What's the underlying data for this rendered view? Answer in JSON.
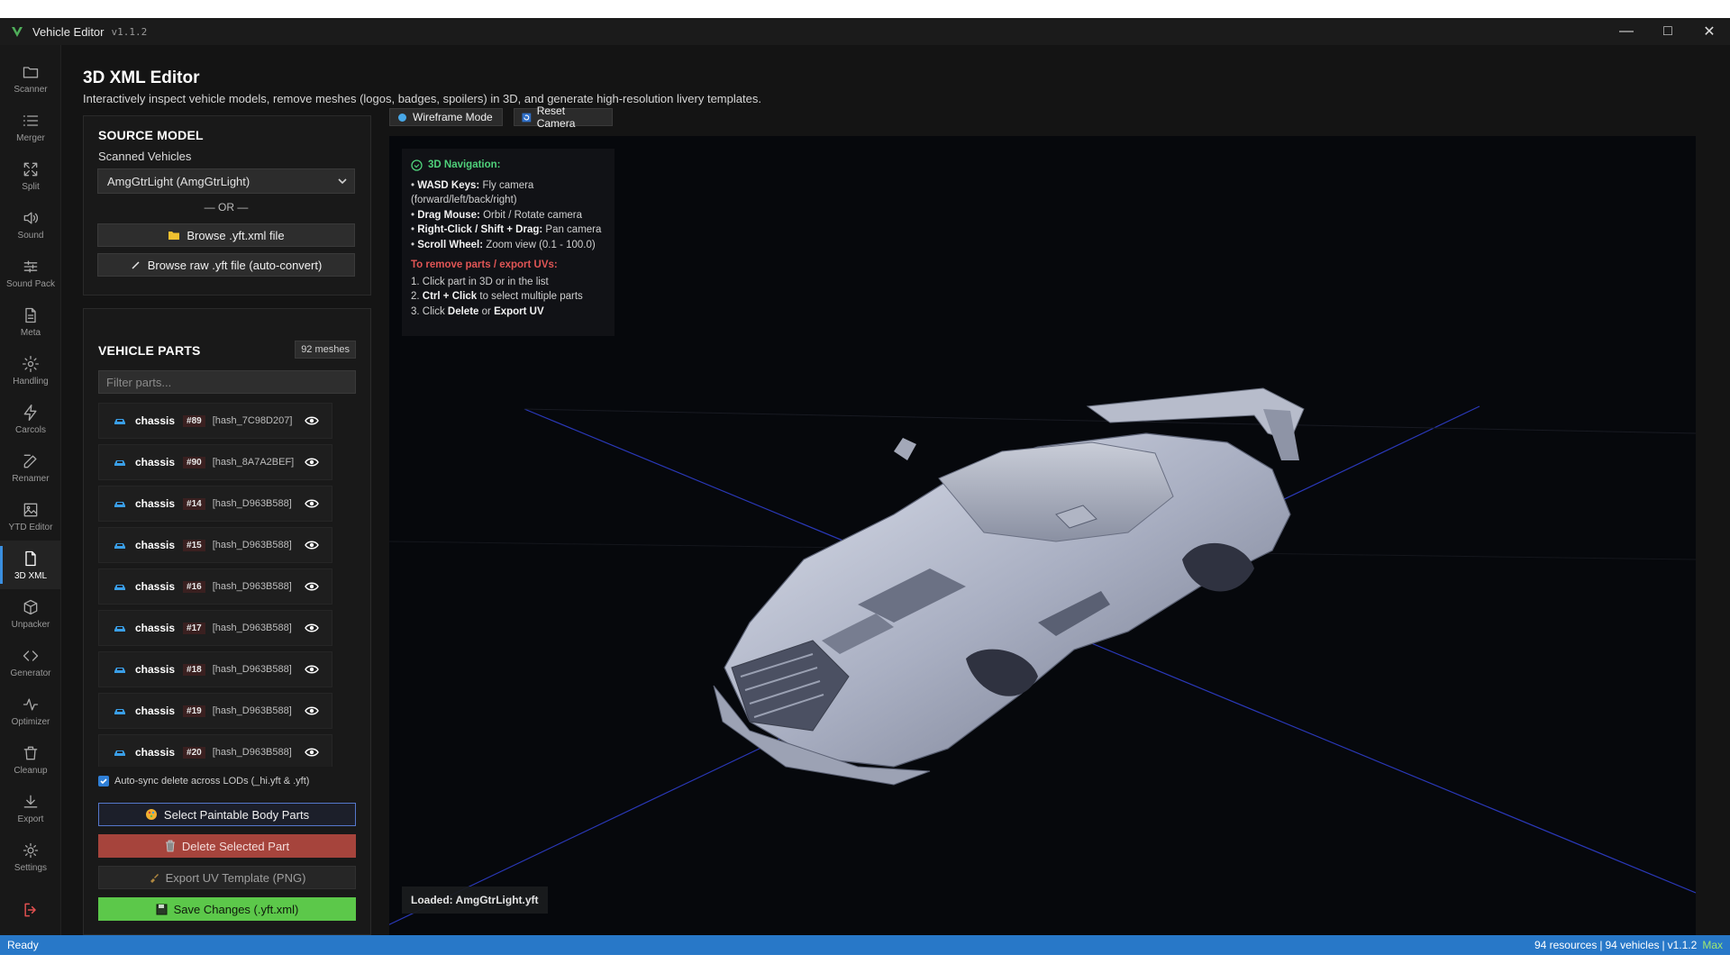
{
  "window": {
    "title": "Vehicle Editor",
    "version": "v1.1.2",
    "controls": [
      "minimize",
      "maximize",
      "close"
    ]
  },
  "nav": {
    "items": [
      {
        "label": "Scanner",
        "icon": "folder-icon"
      },
      {
        "label": "Merger",
        "icon": "list-icon"
      },
      {
        "label": "Split",
        "icon": "expand-icon"
      },
      {
        "label": "Sound",
        "icon": "speaker-icon"
      },
      {
        "label": "Sound Pack",
        "icon": "sliders-icon"
      },
      {
        "label": "Meta",
        "icon": "document-icon"
      },
      {
        "label": "Handling",
        "icon": "gear-icon"
      },
      {
        "label": "Carcols",
        "icon": "lightning-icon"
      },
      {
        "label": "Renamer",
        "icon": "edit-icon"
      },
      {
        "label": "YTD Editor",
        "icon": "image-icon"
      },
      {
        "label": "3D XML",
        "icon": "file-3d-icon"
      },
      {
        "label": "Unpacker",
        "icon": "box-icon"
      },
      {
        "label": "Generator",
        "icon": "code-icon"
      },
      {
        "label": "Optimizer",
        "icon": "pulse-icon"
      },
      {
        "label": "Cleanup",
        "icon": "trash-icon"
      },
      {
        "label": "Export",
        "icon": "download-icon"
      },
      {
        "label": "Settings",
        "icon": "settings-icon"
      }
    ],
    "active": "3D XML"
  },
  "header": {
    "title": "3D XML Editor",
    "subtitle": "Interactively inspect vehicle models, remove meshes (logos, badges, spoilers) in 3D, and generate high-resolution livery templates."
  },
  "source": {
    "heading": "SOURCE MODEL",
    "label": "Scanned Vehicles",
    "selected": "AmgGtrLight (AmgGtrLight)",
    "or": "— OR —",
    "browse_xml": "Browse .yft.xml file",
    "browse_raw": "Browse raw .yft file (auto-convert)"
  },
  "parts": {
    "heading": "VEHICLE PARTS",
    "count": "92 meshes",
    "filter_placeholder": "Filter parts...",
    "rows": [
      {
        "name": "chassis",
        "num": "#89",
        "hash": "[hash_7C98D207]"
      },
      {
        "name": "chassis",
        "num": "#90",
        "hash": "[hash_8A7A2BEF]"
      },
      {
        "name": "chassis",
        "num": "#14",
        "hash": "[hash_D963B588]"
      },
      {
        "name": "chassis",
        "num": "#15",
        "hash": "[hash_D963B588]"
      },
      {
        "name": "chassis",
        "num": "#16",
        "hash": "[hash_D963B588]"
      },
      {
        "name": "chassis",
        "num": "#17",
        "hash": "[hash_D963B588]"
      },
      {
        "name": "chassis",
        "num": "#18",
        "hash": "[hash_D963B588]"
      },
      {
        "name": "chassis",
        "num": "#19",
        "hash": "[hash_D963B588]"
      },
      {
        "name": "chassis",
        "num": "#20",
        "hash": "[hash_D963B588]"
      }
    ],
    "autosync": "Auto-sync delete across LODs (_hi.yft & .yft)",
    "select_paintable": "Select Paintable Body Parts",
    "delete_selected": "Delete Selected Part",
    "export_uv": "Export UV Template (PNG)",
    "save": "Save Changes (.yft.xml)"
  },
  "viewport": {
    "wireframe": "Wireframe Mode",
    "reset_camera": "Reset Camera",
    "help": {
      "title": "3D Navigation:",
      "lines": [
        {
          "key": "WASD Keys:",
          "text": " Fly camera (forward/left/back/right)"
        },
        {
          "key": "Drag Mouse:",
          "text": " Orbit / Rotate camera"
        },
        {
          "key": "Right-Click / Shift + Drag:",
          "text": " Pan camera"
        },
        {
          "key": "Scroll Wheel:",
          "text": " Zoom view (0.1 - 100.0)"
        }
      ],
      "remove_title": "To remove parts / export UVs:",
      "step1": "1. Click part in 3D or in the list",
      "step2_key": "Ctrl + Click",
      "step2_text": " to select multiple parts",
      "step3_pre": "3. Click ",
      "step3_a": "Delete",
      "step3_mid": " or ",
      "step3_b": "Export UV"
    },
    "loaded": "Loaded: AmgGtrLight.yft"
  },
  "status": {
    "left": "Ready",
    "resources": "94 resources",
    "vehicles": "94 vehicles",
    "version": "v1.1.2",
    "max": "Max"
  },
  "colors": {
    "accent": "#2878c8",
    "danger": "#a6443c",
    "success": "#5cc84a",
    "help_title": "#4fd07a",
    "help_warn": "#e05555"
  }
}
